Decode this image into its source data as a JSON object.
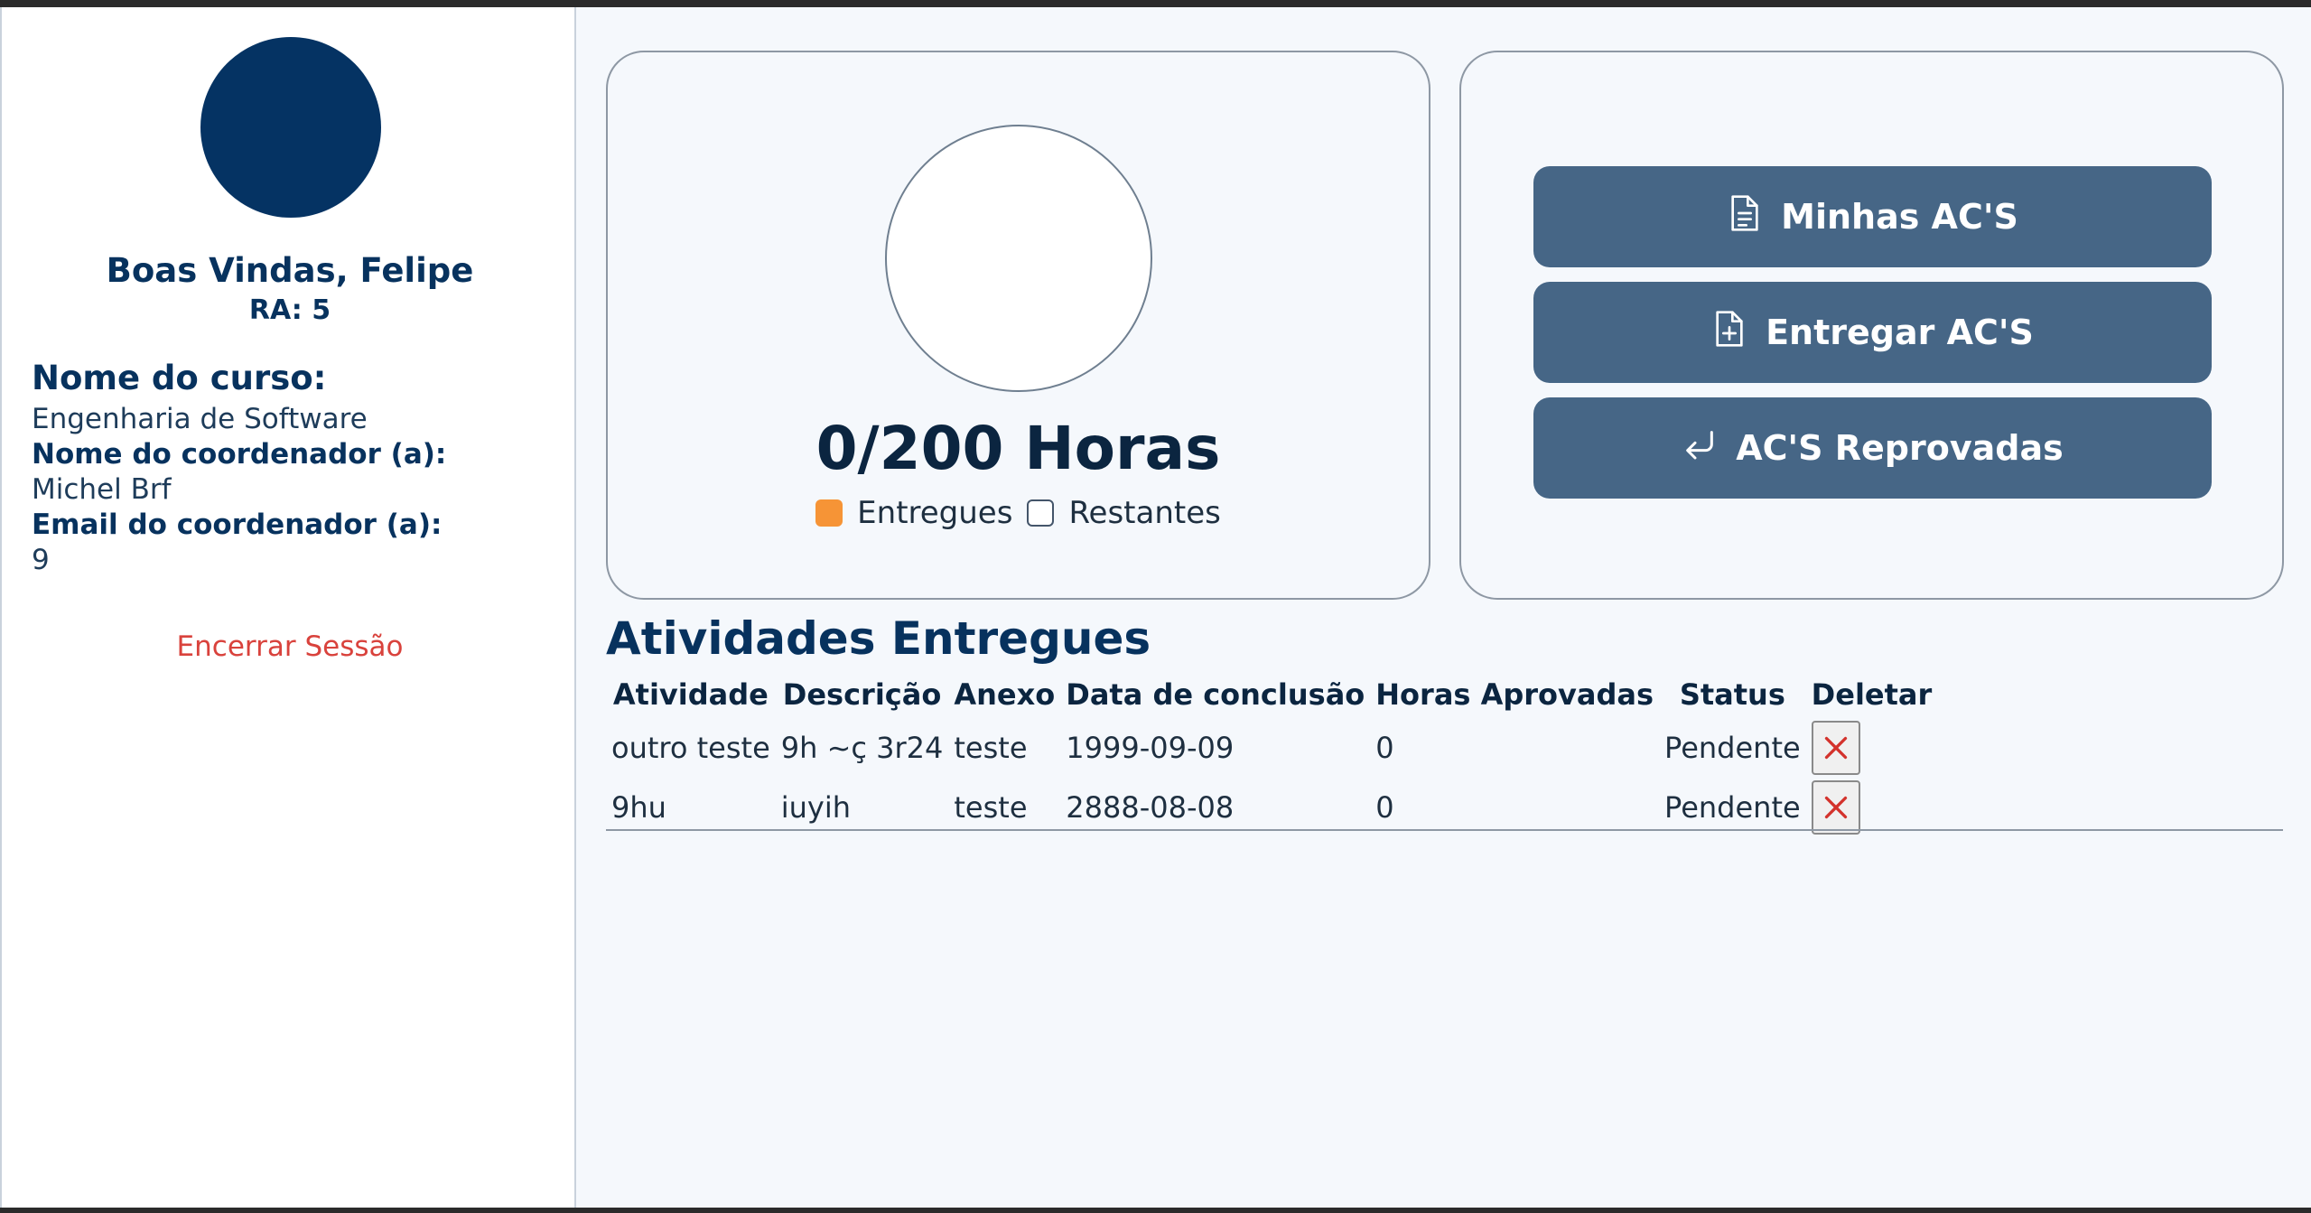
{
  "sidebar": {
    "welcome": "Boas Vindas, Felipe",
    "ra": "RA: 5",
    "course_label": "Nome do curso:",
    "course_value": "Engenharia de Software",
    "coordinator_label": "Nome do coordenador (a):",
    "coordinator_value": "Michel Brf",
    "email_label": "Email do coordenador (a):",
    "email_value": "9",
    "logout": "Encerrar Sessão"
  },
  "progress": {
    "delivered_hours": 0,
    "total_hours": 200,
    "hours_text": "0/200 Horas",
    "legend": [
      "Entregues",
      "Restantes"
    ],
    "colors": {
      "delivered": "#f69436",
      "remaining": "#ffffff"
    }
  },
  "actions": {
    "my_acs": "Minhas AC'S",
    "deliver_acs": "Entregar AC'S",
    "rejected_acs": "AC'S Reprovadas",
    "button_color": "#466686"
  },
  "activities": {
    "title": "Atividades Entregues",
    "headers": [
      "Atividade",
      "Descrição",
      "Anexo",
      "Data de conclusão",
      "Horas Aprovadas",
      "Status",
      "Deletar"
    ],
    "rows": [
      [
        "outro teste",
        "9h ~ç 3r24",
        "teste",
        "1999-09-09",
        "0",
        "Pendente"
      ],
      [
        "9hu",
        "iuyih",
        "teste",
        "2888-08-08",
        "0",
        "Pendente"
      ]
    ]
  },
  "icons": {
    "delete": "close-icon",
    "my_acs": "document-icon",
    "deliver": "document-plus-icon",
    "rejected": "return-arrow-icon"
  }
}
